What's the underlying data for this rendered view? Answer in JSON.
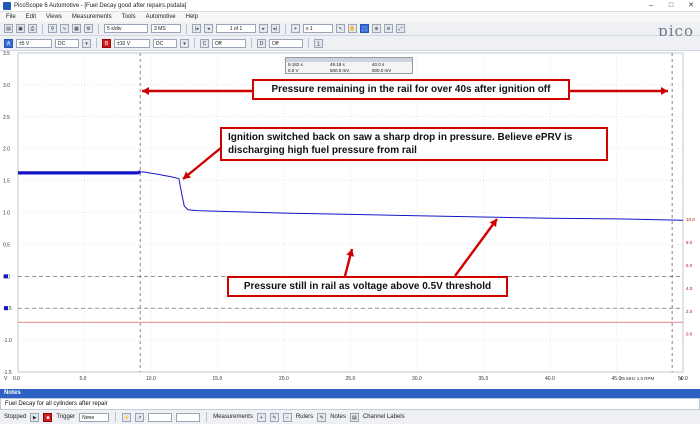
{
  "window": {
    "title": "PicoScope 6 Automotive - [Fuel Decay good after repairs.psdata]",
    "controls": [
      "–",
      "□",
      "✕"
    ]
  },
  "menu": [
    "File",
    "Edit",
    "Views",
    "Measurements",
    "Tools",
    "Automotive",
    "Help"
  ],
  "toolbar1": {
    "timebase": "5 s/div",
    "samples": "3 MS",
    "buffer": "1 of 1",
    "zoom": "x 1"
  },
  "toolbar2": {
    "chA_range": "±5 V",
    "chA_coupling": "DC",
    "chB_range": "±10 V",
    "chB_coupling": "DC",
    "chC_state": "Off",
    "chD_state": "Off"
  },
  "logo": {
    "brand": "pico",
    "sub": "Technology"
  },
  "readout": {
    "rows": [
      [
        "9.182 s",
        "49.18 s",
        "40.0 s"
      ],
      [
        "0.0 V",
        "500.0 mV",
        "500.0 mV"
      ]
    ]
  },
  "axes": {
    "left_ticks": [
      "3.5",
      "3.0",
      "2.5",
      "2.0",
      "1.5",
      "1.0",
      "0.5",
      "0.0",
      "-0.5",
      "-1.0",
      "-1.5"
    ],
    "right_ticks": [
      "10.0",
      "8.0",
      "6.0",
      "4.0",
      "2.0",
      "0.0"
    ],
    "x_ticks": [
      "0.0",
      "5.0",
      "10.0",
      "15.0",
      "20.0",
      "25.0",
      "30.0",
      "35.0",
      "40.0",
      "45.0",
      "50.0"
    ],
    "left_unit": "V",
    "x_unit": "s",
    "status": "25 MHz 1.5 RPM"
  },
  "annotations": {
    "top": "Pressure remaining in the rail for over 40s after ignition off",
    "middle": "Ignition switched back on saw a sharp drop in pressure. Believe ePRV is discharging high fuel pressure from rail",
    "bottom": "Pressure still in rail as voltage above 0.5V threshold"
  },
  "notes": {
    "header": "Notes",
    "body": "Fuel Decay for all cylinders after repair"
  },
  "statusbar": {
    "stopped": "Stopped",
    "trigger_label": "Trigger",
    "trigger_value": "None",
    "measurements": "Measurements",
    "rulers": "Rulers",
    "notes": "Notes",
    "channel_labels": "Channel Labels"
  },
  "colors": {
    "trace": "#1515c8",
    "annotation_border": "#d10000",
    "notes_header": "#2d62c4"
  },
  "chart_data": {
    "type": "line",
    "xlabel": "s",
    "ylabel": "V",
    "xlim": [
      0,
      50
    ],
    "ylim": [
      -1.5,
      3.5
    ],
    "series": [
      {
        "x": [
          0,
          9,
          9.2,
          9.6,
          10.5,
          11.5,
          12.1,
          12.3,
          12.5,
          12.8,
          13.5,
          15,
          20,
          25,
          30,
          35,
          40,
          45,
          50
        ],
        "y": [
          1.62,
          1.62,
          1.64,
          1.63,
          1.6,
          1.56,
          1.53,
          1.3,
          1.1,
          1.04,
          1.03,
          1.02,
          0.99,
          0.97,
          0.95,
          0.93,
          0.91,
          0.9,
          0.88
        ]
      }
    ],
    "reference_lines": {
      "threshold_dashed_y": [
        0.0,
        -0.5
      ],
      "red_line_y": -0.72
    },
    "rulers_x": [
      9.182,
      49.18
    ]
  }
}
